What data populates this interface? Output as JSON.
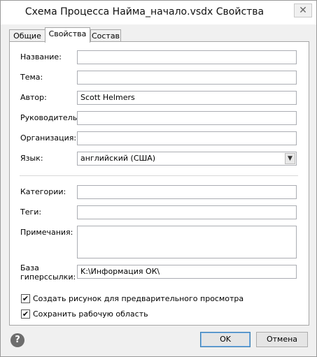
{
  "window": {
    "title": "Схема Процесса Найма_начало.vsdx Свойства",
    "close_glyph": "✕"
  },
  "tabs": [
    {
      "label": "Общие"
    },
    {
      "label": "Свойства"
    },
    {
      "label": "Состав"
    }
  ],
  "fields": {
    "title": {
      "label": "Название:",
      "value": ""
    },
    "subject": {
      "label": "Тема:",
      "value": ""
    },
    "author": {
      "label": "Автор:",
      "value": "Scott Helmers"
    },
    "manager": {
      "label": "Руководитель:",
      "value": ""
    },
    "company": {
      "label": "Организация:",
      "value": ""
    },
    "language": {
      "label": "Язык:",
      "value": "английский (США)"
    },
    "categories": {
      "label": "Категории:",
      "value": ""
    },
    "tags": {
      "label": "Теги:",
      "value": ""
    },
    "comments": {
      "label": "Примечания:",
      "value": ""
    },
    "hyperlink_base": {
      "label_line1": "База",
      "label_line2": "гиперссылки:",
      "value": "K:\\Информация ОК\\"
    }
  },
  "checkboxes": [
    {
      "label": "Создать рисунок для предварительного просмотра",
      "checked": true,
      "mark": "✔"
    },
    {
      "label": "Сохранить рабочую область",
      "checked": true,
      "mark": "✔"
    }
  ],
  "buttons": {
    "ok": "OK",
    "cancel": "Отмена",
    "help_glyph": "?"
  }
}
